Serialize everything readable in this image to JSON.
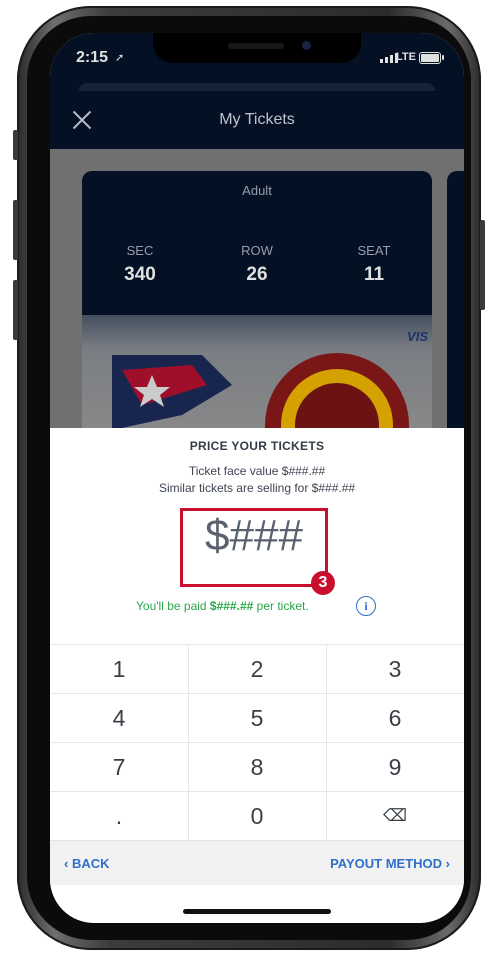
{
  "status_bar": {
    "time": "2:15",
    "location_icon": "➚",
    "network": "LTE"
  },
  "header": {
    "title": "My Tickets",
    "close_icon": "close-icon"
  },
  "ticket": {
    "type": "Adult",
    "sec_label": "SEC",
    "sec": "340",
    "row_label": "ROW",
    "row": "26",
    "seat_label": "SEAT",
    "seat": "11",
    "card_logo": "VIS"
  },
  "pricing": {
    "title": "PRICE YOUR TICKETS",
    "face_value": "Ticket face value $###.##",
    "similar": "Similar tickets are selling for $###.##",
    "price": "$###",
    "step_badge": "3",
    "paid_prefix": "You'll be paid ",
    "paid_amount": "$###.##",
    "paid_suffix": " per ticket.",
    "info_icon": "i"
  },
  "keypad": {
    "keys": [
      "1",
      "2",
      "3",
      "4",
      "5",
      "6",
      "7",
      "8",
      "9",
      ".",
      "0",
      "⌫"
    ]
  },
  "footer": {
    "back": "‹ BACK",
    "payout": "PAYOUT METHOD ›"
  },
  "colors": {
    "navy": "#05132a",
    "accent_red": "#c8102e",
    "link_blue": "#2f6fc9",
    "paid_green": "#2aa84a"
  }
}
